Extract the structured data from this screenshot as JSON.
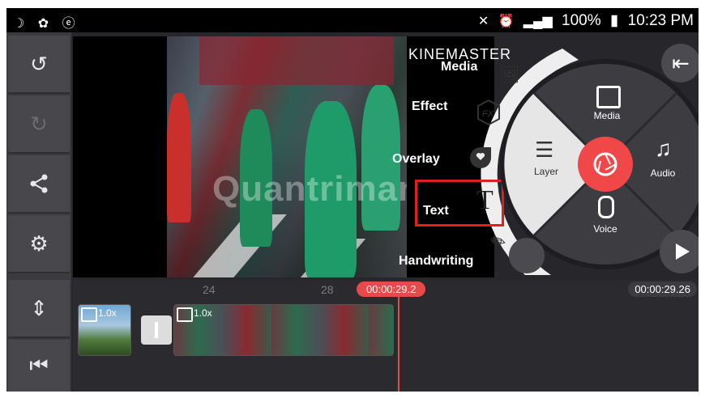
{
  "status_bar": {
    "battery": "100%",
    "time": "10:23 PM"
  },
  "left_toolbar": {
    "undo": "undo-icon",
    "redo": "redo-icon",
    "share": "share-icon",
    "settings": "settings-icon"
  },
  "preview": {
    "logo_text": "KINEMASTER",
    "watermark": "Quantrimang"
  },
  "layer_menu": {
    "items": [
      {
        "label": "Media"
      },
      {
        "label": "Effect"
      },
      {
        "label": "Overlay"
      },
      {
        "label": "Text"
      },
      {
        "label": "Handwriting"
      }
    ],
    "highlight_color": "#e02020"
  },
  "main_wheel": {
    "media": "Media",
    "audio": "Audio",
    "voice": "Voice",
    "layer": "Layer",
    "record_color": "#f04848"
  },
  "timeline": {
    "ruler_ticks": [
      "24",
      "28"
    ],
    "current_time": "00:00:29.2",
    "total_time": "00:00:29.26",
    "clip1_speed": "1.0x",
    "clip2_speed": "1.0x",
    "playhead_color": "#e84a4a"
  }
}
